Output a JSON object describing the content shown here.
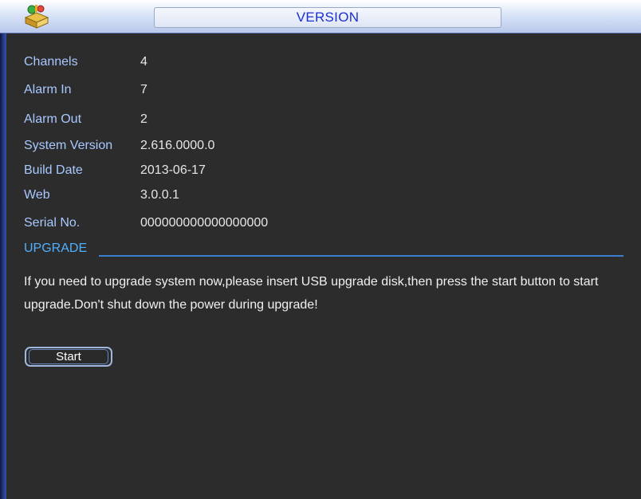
{
  "window": {
    "title": "VERSION",
    "icon": "app-package-icon"
  },
  "info": [
    {
      "label": "Channels",
      "value": "4"
    },
    {
      "label": "Alarm In",
      "value": "7"
    },
    {
      "label": "Alarm Out",
      "value": "2"
    },
    {
      "label": "System Version",
      "value": "2.616.0000.0"
    },
    {
      "label": "Build Date",
      "value": "2013-06-17"
    },
    {
      "label": "Web",
      "value": "3.0.0.1"
    },
    {
      "label": "Serial No.",
      "value": "000000000000000000"
    }
  ],
  "upgrade": {
    "section_title": "UPGRADE",
    "message": "If you need to upgrade system now,please insert USB upgrade disk,then press the start button to start upgrade.Don't shut down the power during upgrade!",
    "start_label": "Start"
  },
  "colors": {
    "label": "#a8c8ff",
    "value": "#e6e6e6",
    "section": "#4fb0ff",
    "title": "#1a2fd6"
  }
}
